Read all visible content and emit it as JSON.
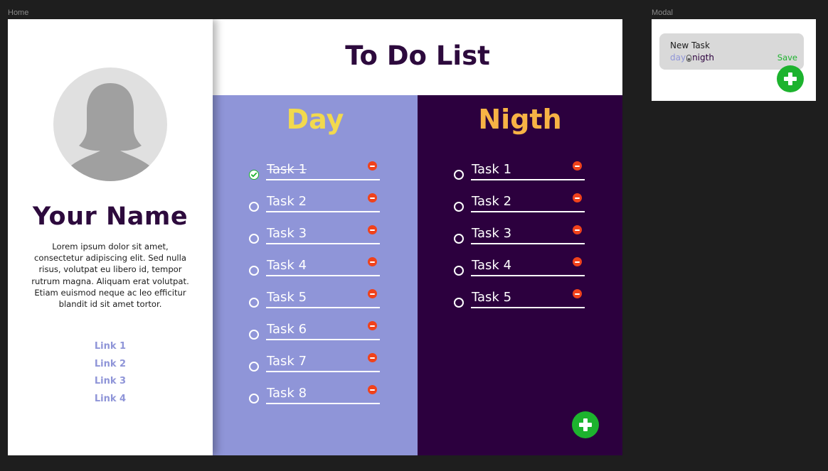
{
  "frames": {
    "home_label": "Home",
    "modal_label": "Modal"
  },
  "profile": {
    "name": "Your Name",
    "bio": "Lorem ipsum dolor sit amet, consectetur adipiscing elit. Sed nulla risus, volutpat eu libero id, tempor rutrum magna. Aliquam erat volutpat. Etiam euismod neque ac leo efficitur blandit id sit amet tortor.",
    "avatar_icon": "person-silhouette-icon"
  },
  "links": [
    {
      "label": "Link 1"
    },
    {
      "label": "Link 2"
    },
    {
      "label": "Link 3"
    },
    {
      "label": "Link 4"
    }
  ],
  "page_title": "To Do List",
  "day": {
    "title": "Day",
    "tasks": [
      {
        "label": "Task 1",
        "done": true
      },
      {
        "label": "Task 2",
        "done": false
      },
      {
        "label": "Task 3",
        "done": false
      },
      {
        "label": "Task 4",
        "done": false
      },
      {
        "label": "Task 5",
        "done": false
      },
      {
        "label": "Task 6",
        "done": false
      },
      {
        "label": "Task 7",
        "done": false
      },
      {
        "label": "Task 8",
        "done": false
      }
    ]
  },
  "night": {
    "title": "Nigth",
    "tasks": [
      {
        "label": "Task 1",
        "done": false
      },
      {
        "label": "Task 2",
        "done": false
      },
      {
        "label": "Task 3",
        "done": false
      },
      {
        "label": "Task 4",
        "done": false
      },
      {
        "label": "Task 5",
        "done": false
      }
    ]
  },
  "modal": {
    "title": "New Task",
    "toggle_day": "day",
    "toggle_night": "nigth",
    "save_label": "Save"
  },
  "colors": {
    "day_bg": "#8f95d8",
    "night_bg": "#2c003e",
    "day_title": "#f2d94e",
    "night_title": "#f7b345",
    "accent_green": "#1db32e",
    "delete_red": "#f0421b",
    "heading": "#2d0a3d"
  },
  "icons": {
    "add": "plus-icon",
    "delete": "minus-circle-icon",
    "check": "check-circle-icon",
    "toggle": "day-night-toggle-icon"
  }
}
